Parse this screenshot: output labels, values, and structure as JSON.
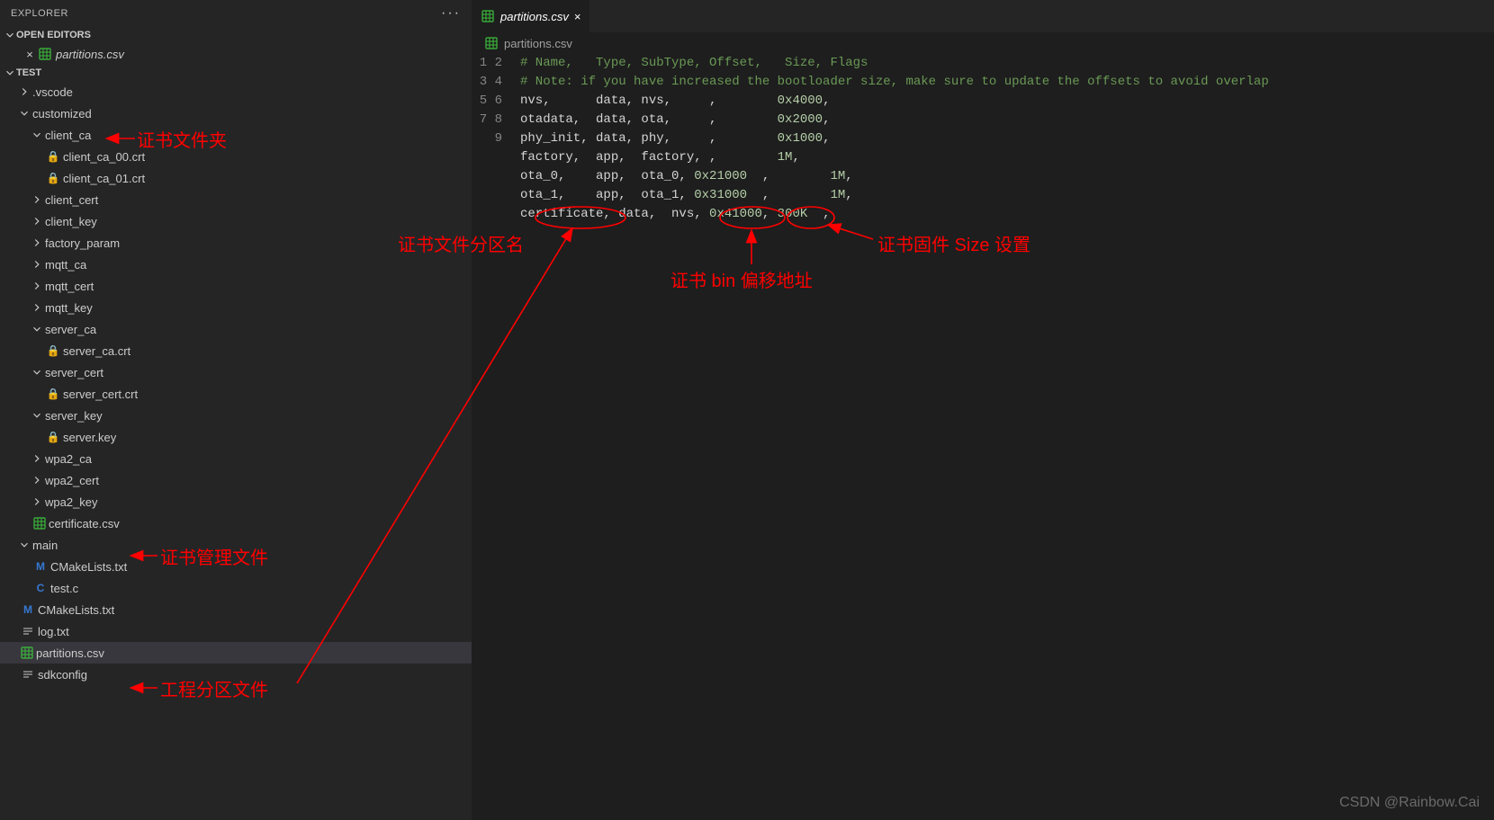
{
  "explorer": {
    "title": "EXPLORER"
  },
  "openEditors": {
    "label": "OPEN EDITORS",
    "item": "partitions.csv"
  },
  "project": {
    "label": "TEST"
  },
  "tree": {
    "vscode": ".vscode",
    "customized": "customized",
    "client_ca": "client_ca",
    "client_ca_00": "client_ca_00.crt",
    "client_ca_01": "client_ca_01.crt",
    "client_cert": "client_cert",
    "client_key": "client_key",
    "factory_param": "factory_param",
    "mqtt_ca": "mqtt_ca",
    "mqtt_cert": "mqtt_cert",
    "mqtt_key": "mqtt_key",
    "server_ca": "server_ca",
    "server_ca_crt": "server_ca.crt",
    "server_cert": "server_cert",
    "server_cert_crt": "server_cert.crt",
    "server_key": "server_key",
    "server_key_file": "server.key",
    "wpa2_ca": "wpa2_ca",
    "wpa2_cert": "wpa2_cert",
    "wpa2_key": "wpa2_key",
    "certificate_csv": "certificate.csv",
    "main": "main",
    "cmakelists_main": "CMakeLists.txt",
    "test_c": "test.c",
    "cmakelists_root": "CMakeLists.txt",
    "log_txt": "log.txt",
    "partitions_csv": "partitions.csv",
    "sdkconfig": "sdkconfig"
  },
  "tab": {
    "name": "partitions.csv"
  },
  "breadcrumb": {
    "file": "partitions.csv"
  },
  "code": {
    "l1": "# Name,   Type, SubType, Offset,   Size, Flags",
    "l2": "# Note: if you have increased the bootloader size, make sure to update the offsets to avoid overlap",
    "l3a": "nvs,      data, nvs,     ,        ",
    "l3b": "0x4000",
    "l3c": ",",
    "l4a": "otadata,  data, ota,     ,        ",
    "l4b": "0x2000",
    "l4c": ",",
    "l5a": "phy_init, data, phy,     ,        ",
    "l5b": "0x1000",
    "l5c": ",",
    "l6a": "factory,  app,  factory, ,        ",
    "l6b": "1M",
    "l6c": ",",
    "l7a": "ota_0,    app,  ota_0, ",
    "l7b": "0x21000",
    "l7c": "  ,        ",
    "l7d": "1M",
    "l7e": ",",
    "l8a": "ota_1,    app,  ota_1, ",
    "l8b": "0x31000",
    "l8c": "  ,        ",
    "l8d": "1M",
    "l8e": ",",
    "l9a": "certificate, data,  nvs, ",
    "l9b": "0x41000",
    "l9c": ", ",
    "l9d": "300K",
    "l9e": "  ,"
  },
  "anno": {
    "cert_folder": "证书文件夹",
    "cert_mgmt_file": "证书管理文件",
    "proj_partition_file": "工程分区文件",
    "cert_partition_name": "证书文件分区名",
    "cert_bin_offset": "证书 bin 偏移地址",
    "cert_size_setting": "证书固件 Size 设置"
  },
  "watermark": "CSDN @Rainbow.Cai"
}
